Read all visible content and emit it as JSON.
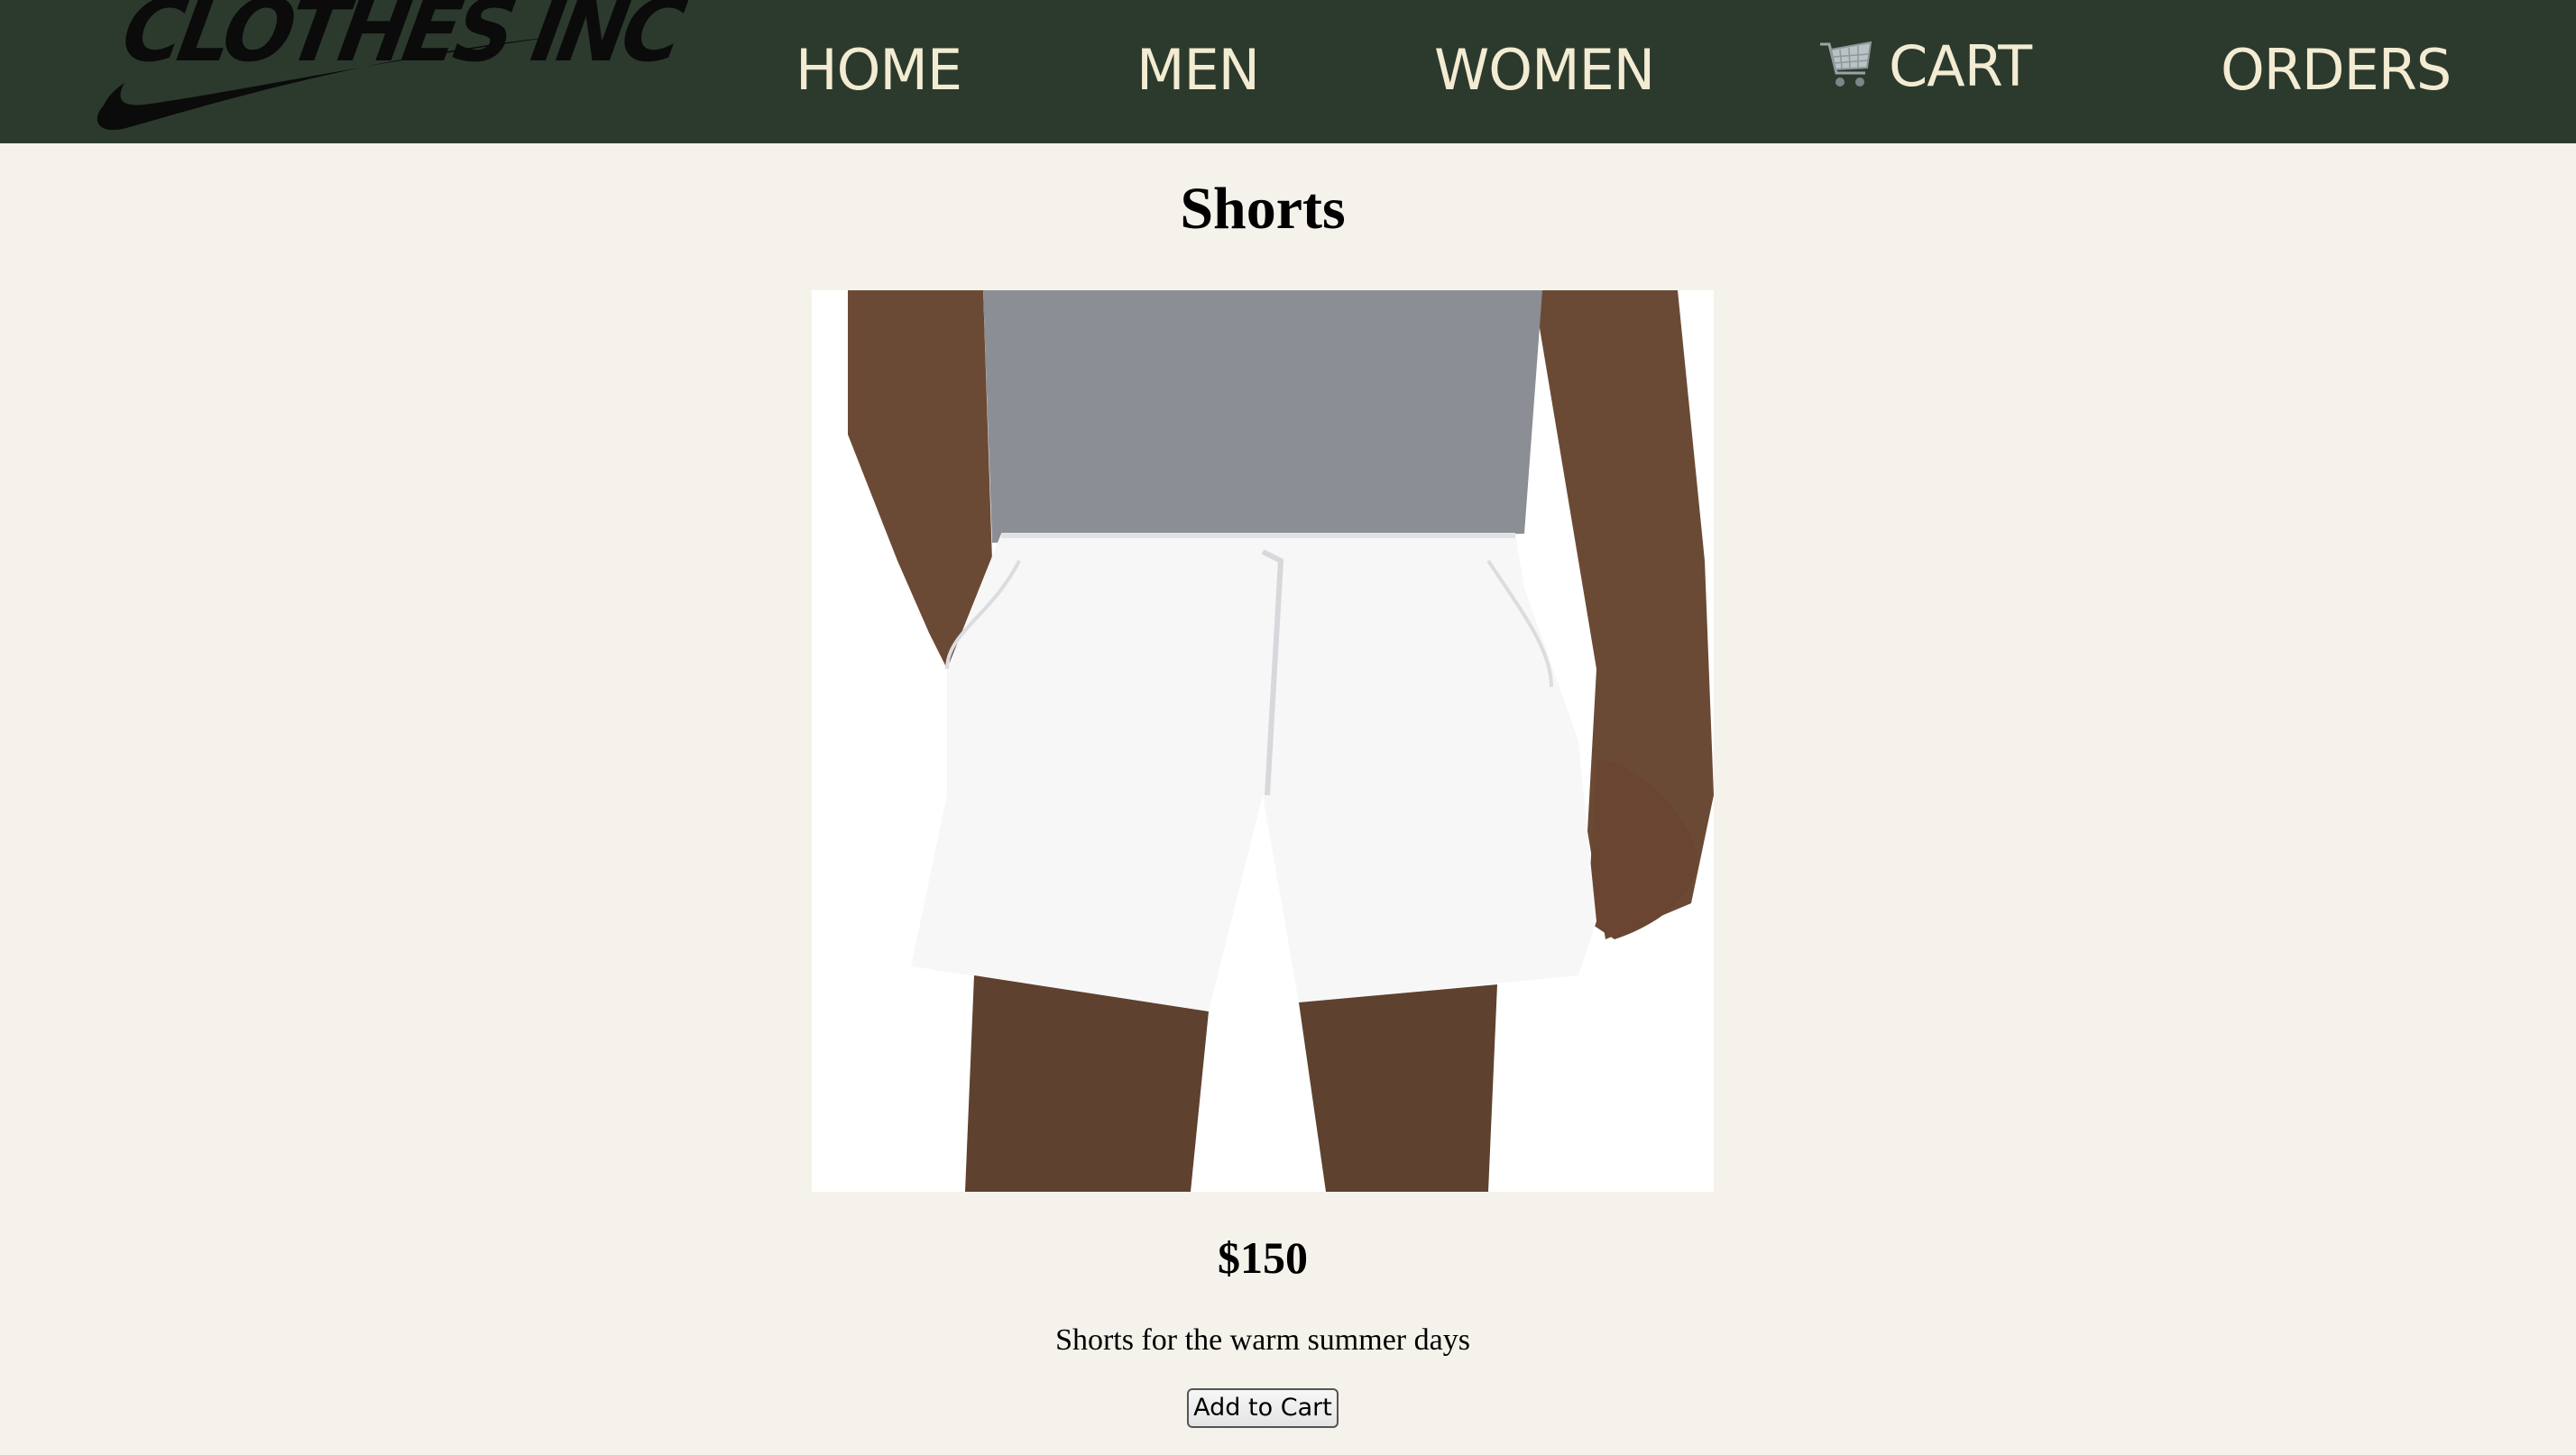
{
  "brand": {
    "logo_text": "CLOTHES INC"
  },
  "nav": {
    "home": "HOME",
    "men": "MEN",
    "women": "WOMEN",
    "cart": "CART",
    "orders": "ORDERS",
    "cart_icon": "shopping-cart-icon"
  },
  "product": {
    "title": "Shorts",
    "image": "product-photo-white-shorts",
    "price": "$150",
    "description": "Shorts for the warm summer days",
    "add_to_cart_label": "Add to Cart"
  },
  "colors": {
    "navbar_bg": "#2c3a2e",
    "nav_text": "#f3ecd2",
    "page_bg": "#f5f2eb"
  }
}
